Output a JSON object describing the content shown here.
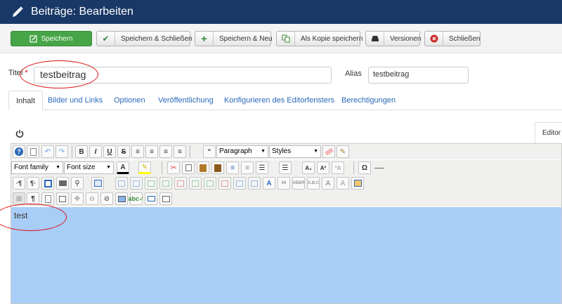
{
  "header": {
    "title": "Beiträge: Bearbeiten",
    "icon": "pencil-icon"
  },
  "toolbar": {
    "save": "Speichern",
    "save_close": "Speichern & Schließen",
    "save_new": "Speichern & Neu",
    "save_copy": "Als Kopie speichern",
    "versions": "Versionen",
    "close": "Schließen"
  },
  "form": {
    "title_label": "Titel",
    "title_required": " *",
    "title_value": "testbeitrag",
    "alias_label": "Alias",
    "alias_value": "testbeitrag"
  },
  "tabs": [
    "Inhalt",
    "Bilder und Links",
    "Optionen",
    "Veröffentlichung",
    "Konfigurieren des Editorfensters",
    "Berechtigungen"
  ],
  "editor": {
    "tab_label": "Editor",
    "format_select": "Paragraph",
    "styles_select": "Styles",
    "font_family_select": "Font family",
    "font_size_select": "Font size",
    "content_text": "test"
  },
  "colors": {
    "header_bg": "#1a3867",
    "save_green": "#46a546",
    "link_blue": "#2a69b8",
    "selection_blue": "#a8cdf7",
    "annotation_red": "#d11111"
  }
}
